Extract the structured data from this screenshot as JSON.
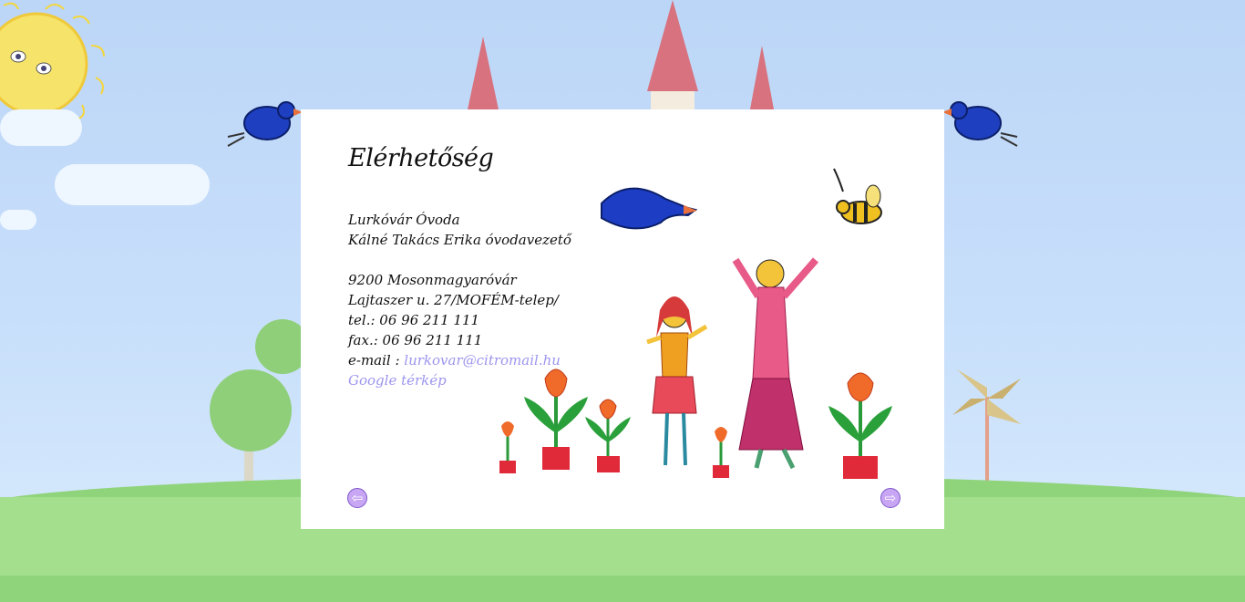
{
  "contact": {
    "title": "Elérhetőség",
    "org_name": "Lurkóvár Óvoda",
    "director": "Kálné Takács Erika óvodavezető",
    "city": "9200 Mosonmagyaróvár",
    "street": "Lajtaszer u. 27/MOFÉM-telep/",
    "tel": "tel.: 06 96 211 111",
    "fax": "fax.: 06 96 211 111",
    "email_label": "e-mail : ",
    "email": "lurkovar@citromail.hu",
    "map_link": "Google térkép"
  },
  "nav": {
    "prev_icon": "arrow-left-icon",
    "next_icon": "arrow-right-icon",
    "prev_glyph": "⇦",
    "next_glyph": "⇨"
  },
  "colors": {
    "link": "#9b95ee",
    "nav_button": "#c8a6f4",
    "sky": "#c4dcf8",
    "grass": "#a3df8c"
  }
}
